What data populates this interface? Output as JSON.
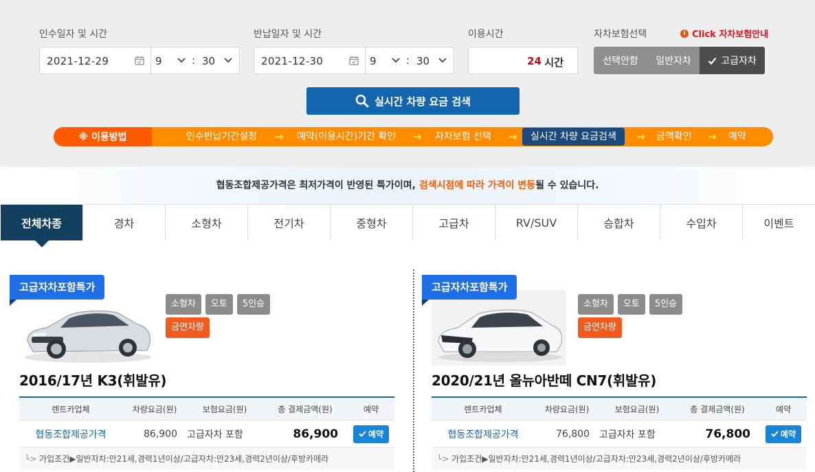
{
  "search": {
    "pickup_label": "인수일자 및 시간",
    "pickup_date": "2021-12-29",
    "pickup_hour": "9",
    "pickup_minute": "30",
    "return_label": "반납일자 및 시간",
    "return_date": "2021-12-30",
    "return_hour": "9",
    "return_minute": "30",
    "duration_label": "이용시간",
    "duration_value": "24",
    "duration_unit": "시간",
    "colon": ":",
    "insurance_label": "자차보험선택",
    "insurance_link": "Click 자차보험안내",
    "insurance_options": [
      "선택안함",
      "일반자차",
      "고급자차"
    ],
    "insurance_selected": "고급자차",
    "search_button": "실시간 차량 요금 검색"
  },
  "steps": {
    "title": "※ 이용방법",
    "items": [
      "인수반납기간설정",
      "예약(이용시간)기간 확인",
      "자차보험 선택",
      "실시간 차량 요금검색",
      "금액확인",
      "예약"
    ],
    "active": "실시간 차량 요금검색",
    "arrow": "→"
  },
  "notice": {
    "prefix": "협동조합제공가격은  최저가격이 반영된 특가이며, ",
    "highlight": "검색시점에 따라 가격이 변동",
    "suffix": "될 수 있습니다."
  },
  "tabs": [
    "전체차종",
    "경차",
    "소형차",
    "전기차",
    "중형차",
    "고급차",
    "RV/SUV",
    "승합차",
    "수입차",
    "이벤트"
  ],
  "cars": [
    {
      "badge": "고급자차포함특가",
      "tags": [
        "소형차",
        "오토",
        "5인승"
      ],
      "smoke": "금연차량",
      "model": "2016/17년 K3(휘발유)",
      "headers": [
        "렌트카업체",
        "차량요금(원)",
        "보험요금(원)",
        "총 결제금액(원)",
        "예약"
      ],
      "vendor": "협동조합제공가격",
      "car_fee": "86,900",
      "insurance": "고급자차 포함",
      "total": "86,900",
      "reserve": "예약",
      "condition": "가입조건▶일반자차:만21세,경력1년이상/고급자차:만23세,경력2년이상/후방카메라"
    },
    {
      "badge": "고급자차포함특가",
      "tags": [
        "소형차",
        "오토",
        "5인승"
      ],
      "smoke": "금연차량",
      "model": "2020/21년 올뉴아반떼 CN7(휘발유)",
      "headers": [
        "렌트카업체",
        "차량요금(원)",
        "보험요금(원)",
        "총 결제금액(원)",
        "예약"
      ],
      "vendor": "협동조합제공가격",
      "car_fee": "76,800",
      "insurance": "고급자차 포함",
      "total": "76,800",
      "reserve": "예약",
      "condition": "가입조건▶일반자차:만21세,경력1년이상/고급자차:만23세,경력2년이상/후방카메라"
    }
  ],
  "colors": {
    "primary": "#1366ad",
    "orange": "#ff8c00",
    "orange_dark": "#ff5a00",
    "tab_active": "#13405f",
    "badge": "#1e6ee6",
    "smoke_tag": "#f35a1d"
  }
}
